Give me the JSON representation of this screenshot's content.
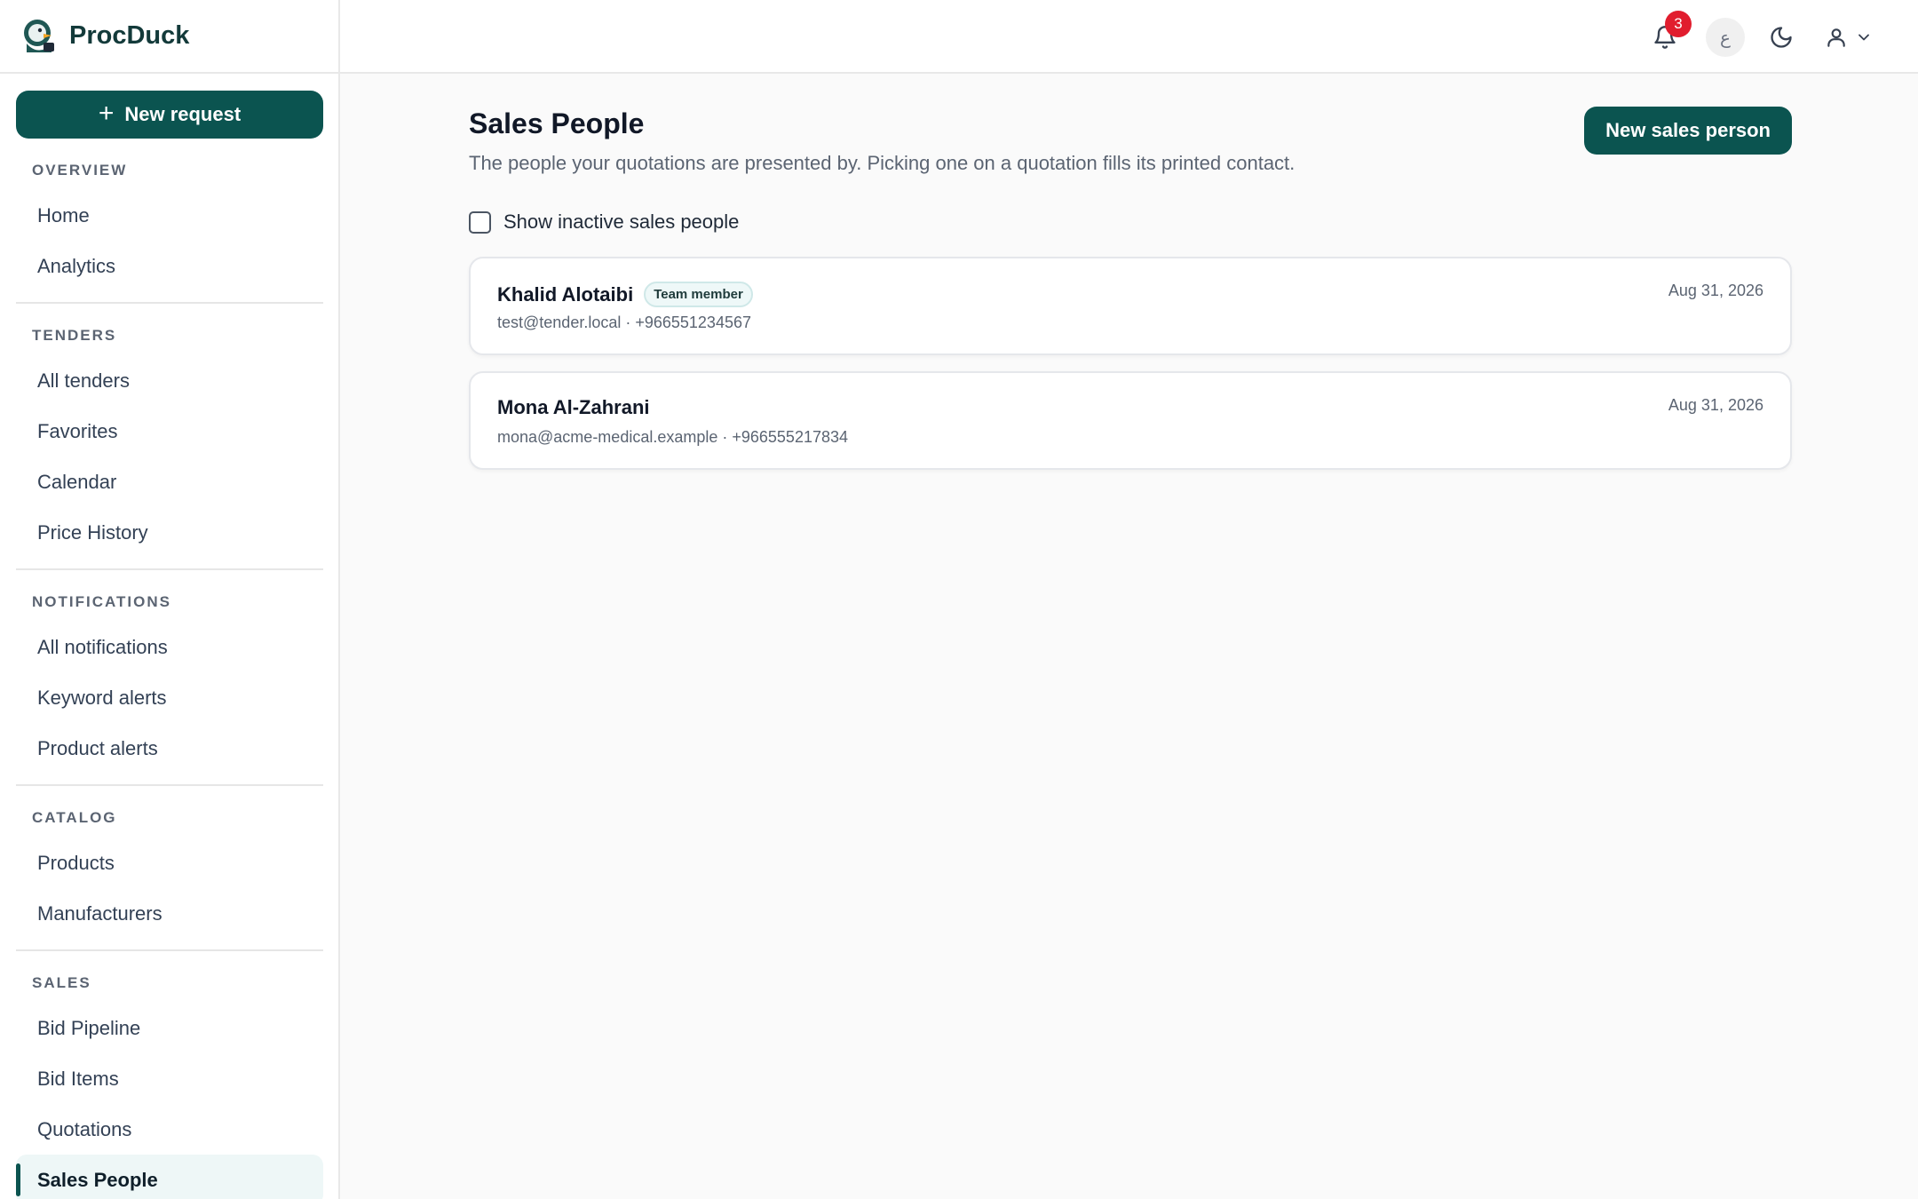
{
  "brand": {
    "name": "ProcDuck"
  },
  "sidebar": {
    "new_request_label": "New request",
    "sections": [
      {
        "title": "OVERVIEW",
        "items": [
          "Home",
          "Analytics"
        ]
      },
      {
        "title": "TENDERS",
        "items": [
          "All tenders",
          "Favorites",
          "Calendar",
          "Price History"
        ]
      },
      {
        "title": "NOTIFICATIONS",
        "items": [
          "All notifications",
          "Keyword alerts",
          "Product alerts"
        ]
      },
      {
        "title": "CATALOG",
        "items": [
          "Products",
          "Manufacturers"
        ]
      },
      {
        "title": "SALES",
        "items": [
          "Bid Pipeline",
          "Bid Items",
          "Quotations",
          "Sales People"
        ]
      }
    ],
    "active_item": "Sales People"
  },
  "topbar": {
    "notification_count": "3",
    "language_glyph": "ع"
  },
  "main": {
    "title": "Sales People",
    "subtitle": "The people your quotations are presented by. Picking one on a quotation fills its printed contact.",
    "new_button_label": "New sales person",
    "show_inactive_label": "Show inactive sales people",
    "sales_people": [
      {
        "name": "Khalid Alotaibi",
        "tag": "Team member",
        "contact": "test@tender.local · +966551234567",
        "date": "Aug 31, 2026"
      },
      {
        "name": "Mona Al-Zahrani",
        "tag": "",
        "contact": "mona@acme-medical.example · +966555217834",
        "date": "Aug 31, 2026"
      }
    ]
  },
  "colors": {
    "accent": "#0b5450",
    "badge": "#e11d2e"
  }
}
